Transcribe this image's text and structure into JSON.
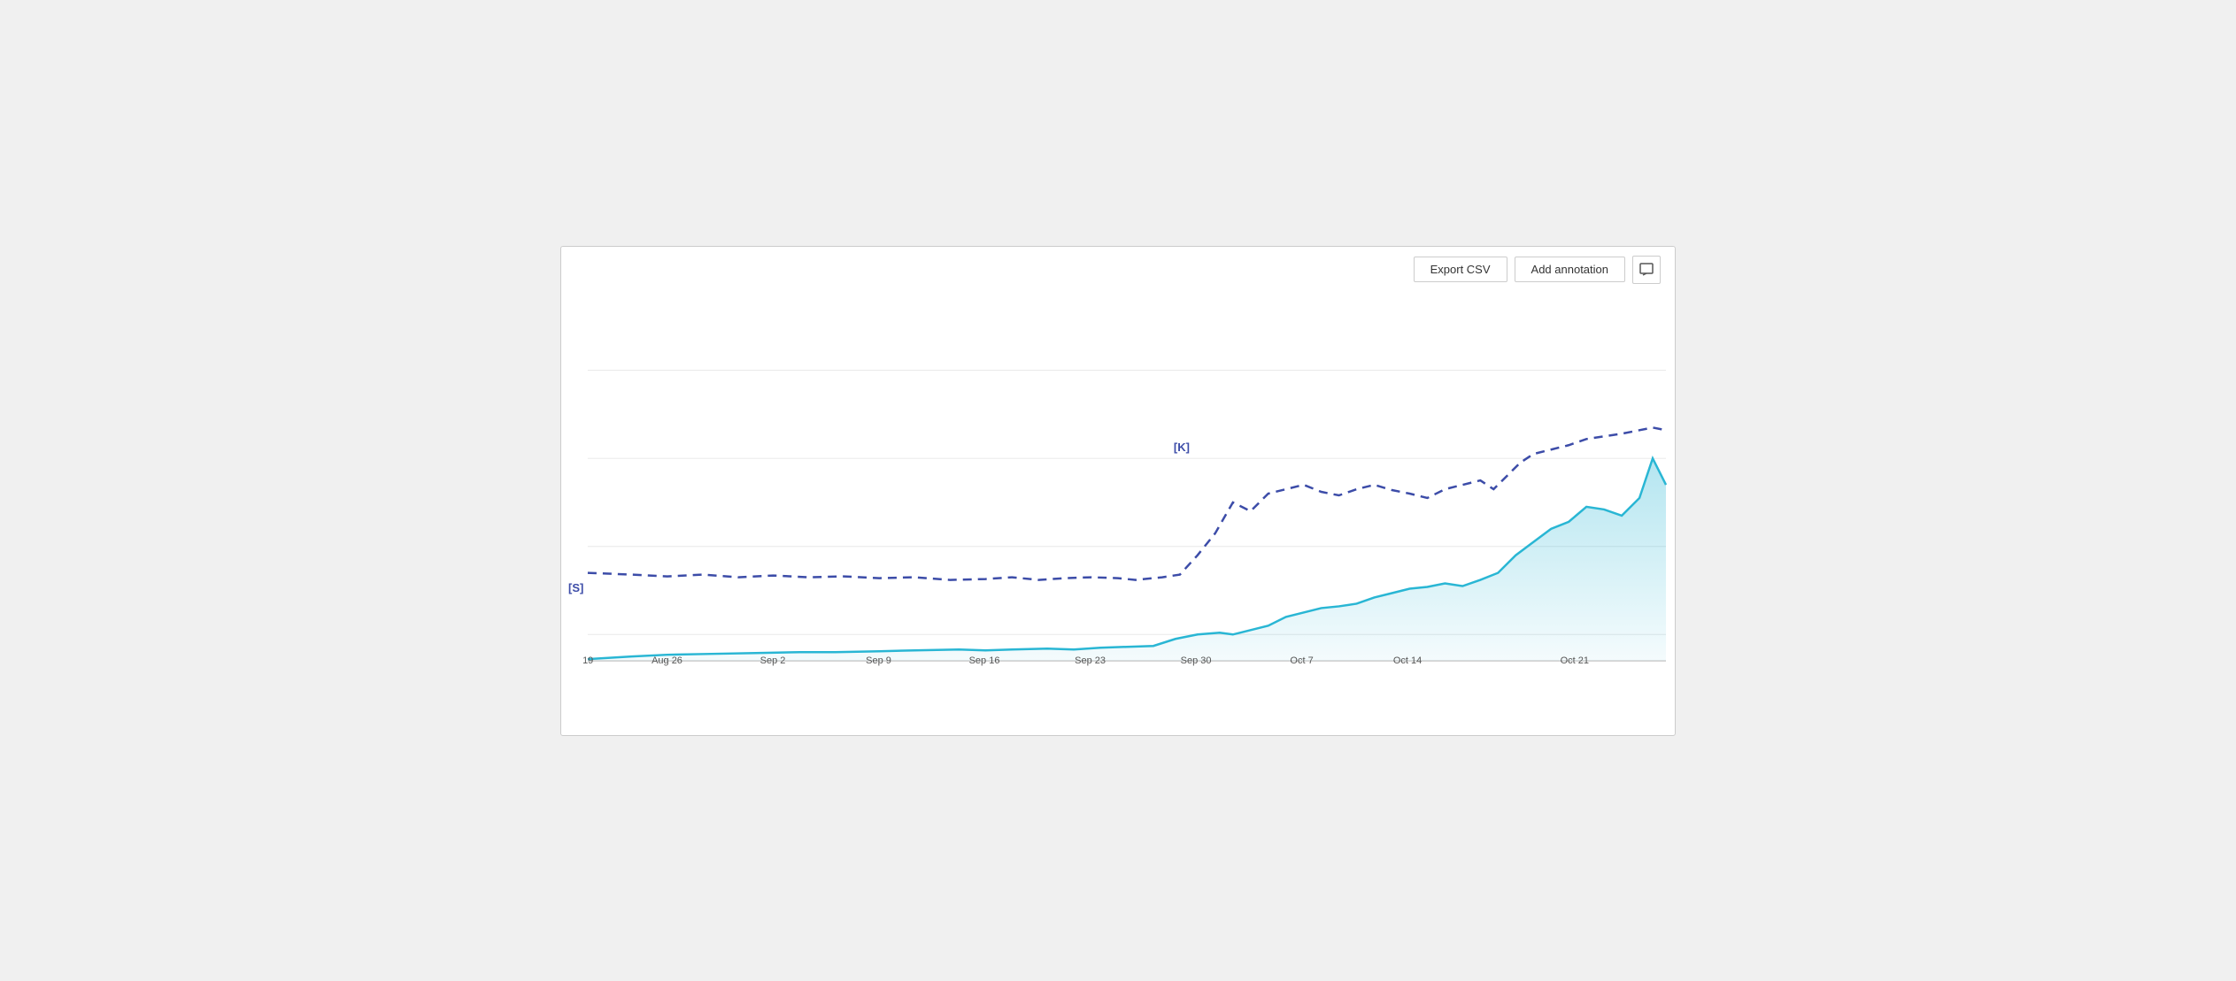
{
  "toolbar": {
    "export_csv_label": "Export CSV",
    "add_annotation_label": "Add annotation",
    "annotation_icon_symbol": "🖊"
  },
  "chart": {
    "x_labels": [
      {
        "label": "19",
        "pct": 0
      },
      {
        "label": "Aug 26",
        "pct": 9.5
      },
      {
        "label": "Sep 2",
        "pct": 19
      },
      {
        "label": "Sep 9",
        "pct": 28.5
      },
      {
        "label": "Sep 16",
        "pct": 38
      },
      {
        "label": "Sep 23",
        "pct": 47.5
      },
      {
        "label": "Sep 30",
        "pct": 57
      },
      {
        "label": "Oct 7",
        "pct": 66.5
      },
      {
        "label": "Oct 14",
        "pct": 76
      },
      {
        "label": "Oct 21",
        "pct": 91
      }
    ],
    "y_labels": [
      {
        "label": "[S]",
        "pct": 75
      },
      {
        "label": "[K]",
        "pct": 40
      }
    ],
    "solid_line_color": "#29b6d4",
    "dashed_line_color": "#3c4ca8",
    "fill_color": "rgba(173, 224, 240, 0.5)"
  }
}
